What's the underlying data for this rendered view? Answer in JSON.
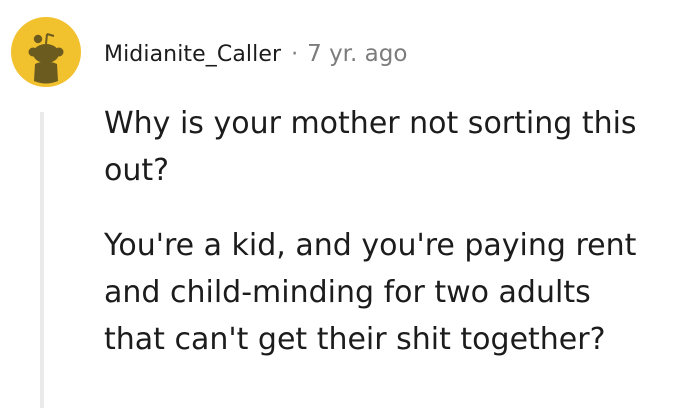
{
  "comment": {
    "author": "Midianite_Caller",
    "separator": "·",
    "age": "7 yr. ago",
    "avatar_icon": "reddit-snoo-avatar-icon",
    "avatar_color": "#f2c12e",
    "paragraphs": [
      {
        "lines": [
          "Why is your mother not sorting this",
          "out?"
        ]
      },
      {
        "lines": [
          "You're a kid, and you're paying rent",
          "and child-minding for two adults",
          "that can't get their shit together?"
        ]
      }
    ]
  }
}
